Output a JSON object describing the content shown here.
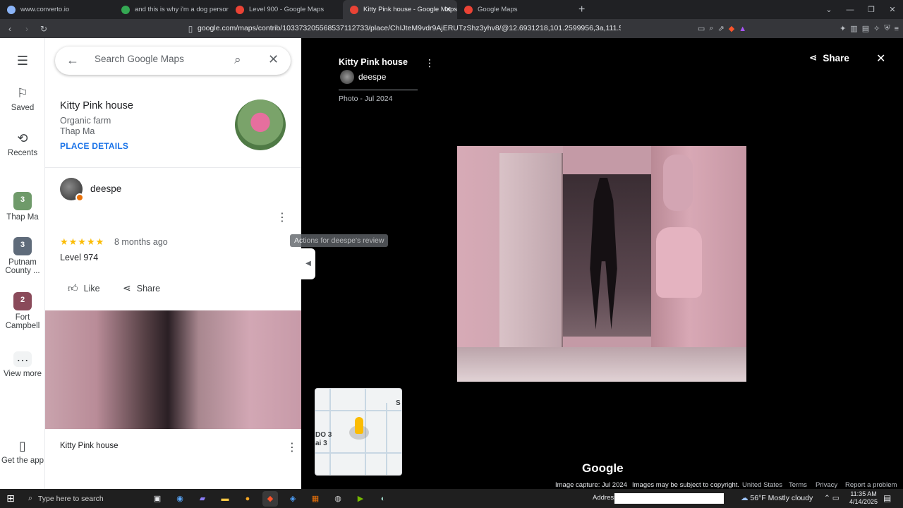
{
  "browser": {
    "tabs": [
      {
        "label": "www.converto.io",
        "icon_color": "#8ab4f8"
      },
      {
        "label": "and this is why i'm a dog person",
        "icon_color": "#34a853"
      },
      {
        "label": "Level 900 - Google Maps",
        "icon_color": "#ea4335"
      },
      {
        "label": "Kitty Pink house - Google Maps",
        "icon_color": "#ea4335",
        "active": true
      },
      {
        "label": "Google Maps",
        "icon_color": "#ea4335"
      }
    ],
    "url": "google.com/maps/contrib/103373205568537112733/place/ChIJteM9vdr9AjERUTzShz3yhv8/@12.6931218,101.2599956,3a,111.5y/data=!3..."
  },
  "rail": {
    "saved": "Saved",
    "recents": "Recents",
    "recent_places": [
      {
        "label": "Thap Ma",
        "count": "3"
      },
      {
        "label": "Putnam County ...",
        "count": "3"
      },
      {
        "label": "Fort Campbell",
        "count": "2"
      }
    ],
    "view_more": "View more",
    "get_app": "Get the app"
  },
  "search": {
    "placeholder": "Search Google Maps"
  },
  "place": {
    "name": "Kitty Pink house",
    "type": "Organic farm",
    "location": "Thap Ma",
    "details_link": "PLACE DETAILS"
  },
  "review": {
    "author": "deespe",
    "stars": "★★★★★",
    "when": "8 months ago",
    "text": "Level 974",
    "like": "Like",
    "share": "Share",
    "photo_caption": "Kitty Pink house",
    "tooltip": "Actions for deespe's review"
  },
  "viewer": {
    "title": "Kitty Pink house",
    "author": "deespe",
    "date": "Photo - Jul 2024",
    "share": "Share",
    "minimap_label_a": "DO 3",
    "minimap_label_b": "ai 3",
    "minimap_label_c": "S"
  },
  "footer": {
    "google": "Google",
    "capture": "Image capture: Jul 2024",
    "copyright": "Images may be subject to copyright.",
    "country": "United States",
    "terms": "Terms",
    "privacy": "Privacy",
    "report": "Report a problem"
  },
  "taskbar": {
    "search_placeholder": "Type here to search",
    "address_label": "Address",
    "weather": "56°F  Mostly cloudy",
    "time": "11:35 AM",
    "date": "4/14/2025"
  }
}
